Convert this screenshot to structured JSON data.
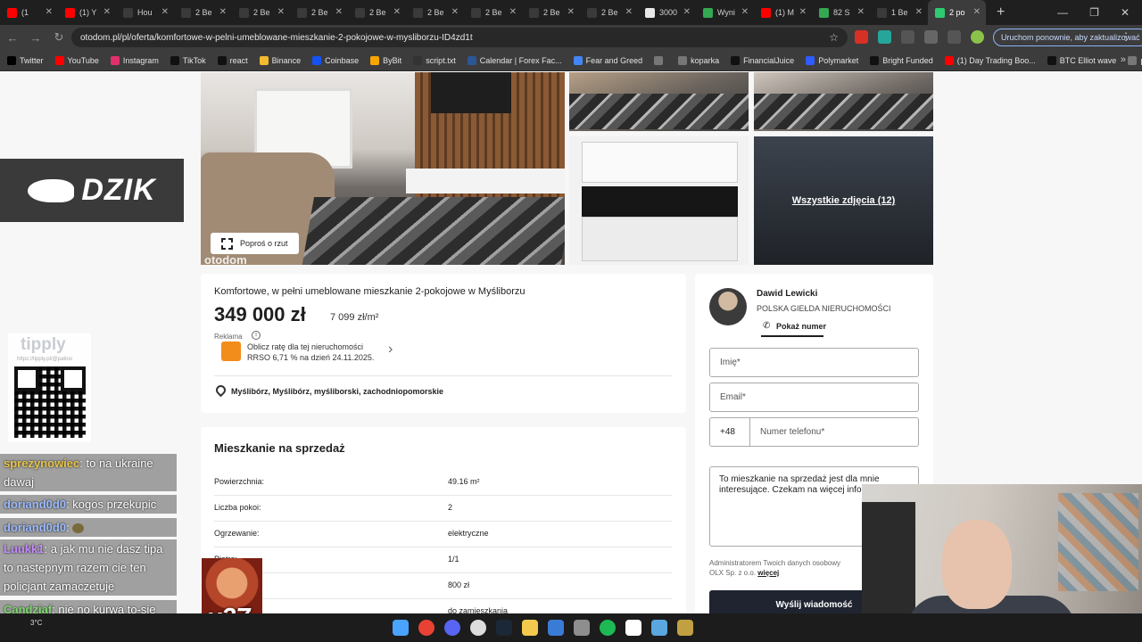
{
  "browser": {
    "tabs": [
      {
        "title": "(1",
        "color": "#ff0000"
      },
      {
        "title": "(1) Y",
        "color": "#ff0000"
      },
      {
        "title": "Hou",
        "color": "#3a3a3a"
      },
      {
        "title": "2 Be",
        "color": "#3a3a3a"
      },
      {
        "title": "2 Be",
        "color": "#3a3a3a"
      },
      {
        "title": "2 Be",
        "color": "#3a3a3a"
      },
      {
        "title": "2 Be",
        "color": "#3a3a3a"
      },
      {
        "title": "2 Be",
        "color": "#3a3a3a"
      },
      {
        "title": "2 Be",
        "color": "#3a3a3a"
      },
      {
        "title": "2 Be",
        "color": "#3a3a3a"
      },
      {
        "title": "2 Be",
        "color": "#3a3a3a"
      },
      {
        "title": "3000",
        "color": "#e8e8e8"
      },
      {
        "title": "Wyni",
        "color": "#34a853"
      },
      {
        "title": "(1) M",
        "color": "#ff0000"
      },
      {
        "title": "82 S",
        "color": "#34a853"
      },
      {
        "title": "1 Be",
        "color": "#3a3a3a"
      },
      {
        "title": "2 po",
        "color": "#2ecc71",
        "active": true
      }
    ],
    "url": "otodom.pl/pl/oferta/komfortowe-w-pelni-umeblowane-mieszkanie-2-pokojowe-w-mysliborzu-ID4zd1t",
    "relaunch_label": "Uruchom ponownie, aby zaktualizować",
    "bookmarks": [
      {
        "label": "Twitter",
        "color": "#000000"
      },
      {
        "label": "YouTube",
        "color": "#ff0000"
      },
      {
        "label": "Instagram",
        "color": "#e1306c"
      },
      {
        "label": "TikTok",
        "color": "#111111"
      },
      {
        "label": "react",
        "color": "#111111"
      },
      {
        "label": "Binance",
        "color": "#f3ba2f"
      },
      {
        "label": "Coinbase",
        "color": "#1652f0"
      },
      {
        "label": "ByBit",
        "color": "#f7a600"
      },
      {
        "label": "script.txt",
        "color": "#333333"
      },
      {
        "label": "Calendar | Forex Fac...",
        "color": "#2b5797"
      },
      {
        "label": "Fear and Greed",
        "color": "#4285f4"
      },
      {
        "label": "",
        "color": "#777777"
      },
      {
        "label": "koparka",
        "color": "#777777"
      },
      {
        "label": "FinancialJuice",
        "color": "#111111"
      },
      {
        "label": "Polymarket",
        "color": "#2e5cff"
      },
      {
        "label": "Bright Funded",
        "color": "#111111"
      },
      {
        "label": "(1) Day Trading Boo...",
        "color": "#ff0000"
      },
      {
        "label": "BTC Elliot wave",
        "color": "#111111"
      },
      {
        "label": "palcówka",
        "color": "#777777"
      }
    ]
  },
  "listing": {
    "title": "Komfortowe, w pełni umeblowane mieszkanie 2-pokojowe w Myśliborzu",
    "price": "349 000 zł",
    "price_per_m2": "7 099 zł/m²",
    "ad_label": "Reklama",
    "ad_line1": "Oblicz ratę dla tej nieruchomości",
    "ad_line2": "RRSO 6,71 % na dzień 24.11.2025.",
    "location": "Myślibórz, Myślibórz, myśliborski, zachodniopomorskie",
    "floor_plan_button": "Poproś o rzut",
    "all_photos": "Wszystkie zdjęcia (12)",
    "watermark": "otodom"
  },
  "details": {
    "section_title": "Mieszkanie na sprzedaż",
    "rows": [
      {
        "k": "Powierzchnia:",
        "v": "49.16 m²"
      },
      {
        "k": "Liczba pokoi:",
        "v": "2"
      },
      {
        "k": "Ogrzewanie:",
        "v": "elektryczne"
      },
      {
        "k": "Piętro:",
        "v": "1/1"
      },
      {
        "k": "",
        "v": "800 zł"
      },
      {
        "k": "...czenia:",
        "v": "do zamieszkania"
      }
    ]
  },
  "contact": {
    "agent_name": "Dawid Lewicki",
    "agency": "POLSKA GIEŁDA NIERUCHOMOŚCI",
    "show_number": "Pokaż numer",
    "name_placeholder": "Imię*",
    "email_placeholder": "Email*",
    "phone_prefix": "+48",
    "phone_placeholder": "Numer telefonu*",
    "message": "To mieszkanie na sprzedaż jest dla mnie interesujące. Czekam na więcej informacji.",
    "admin_note_1": "Administratorem Twoich danych osobowy",
    "admin_note_2": "OLX Sp. z o.o.",
    "admin_note_more": "więcej",
    "send_label": "Wyślij wiadomość"
  },
  "overlay": {
    "dzik": "DZIK",
    "tipply": "tipply",
    "tipply_url": "https://tipply.pl/@patino",
    "emote_count": "x27",
    "weather": "3°C",
    "chat": [
      {
        "user": "sprezynowiec",
        "color": "#e8c64a",
        "text": ": to na ukraine dawaj"
      },
      {
        "user": "doriand0d0",
        "color": "#9bbcff",
        "text": ": kogos przekupic"
      },
      {
        "user": "doriand0d0",
        "color": "#9bbcff",
        "text": ":"
      },
      {
        "user": "Luukk1",
        "color": "#c58bff",
        "text": ": a jak mu nie dasz tipa to nastepnym razem cie ten policjant zamaczetuje"
      },
      {
        "user": "Candziaf",
        "color": "#7fd86f",
        "text": ": nie no kurwa to-się nie dzieje na prawdę"
      }
    ]
  }
}
